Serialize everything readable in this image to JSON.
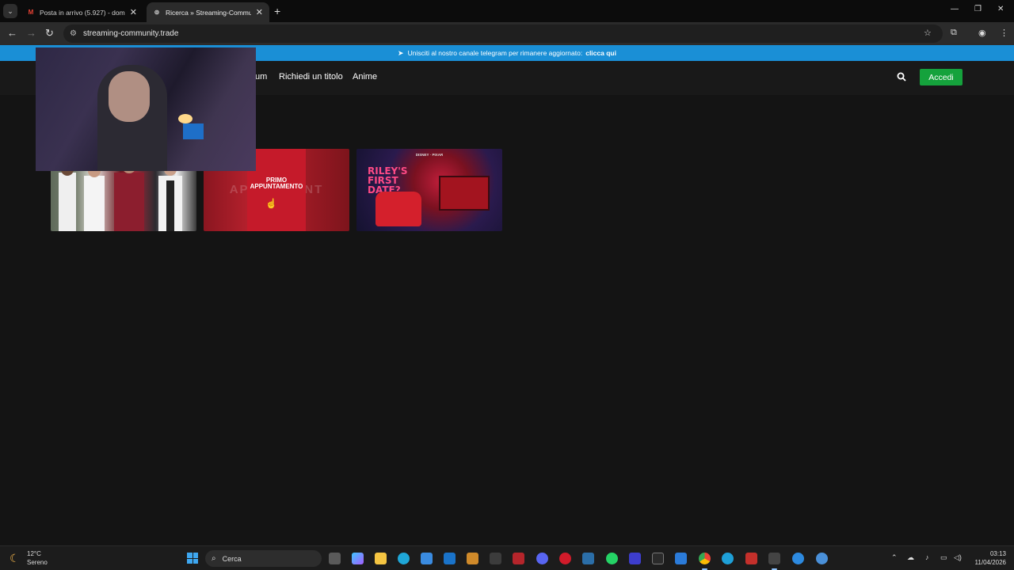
{
  "browser": {
    "tabs": [
      {
        "title": "Posta in arrivo (5.927) - domeni",
        "favicon": "gmail-icon"
      },
      {
        "title": "Ricerca » Streaming-Communit",
        "favicon": "streaming-icon"
      }
    ],
    "url": "streaming-community.trade"
  },
  "banner": {
    "text": "Unisciti al nostro canale telegram per rimanere aggiornato:",
    "cta": "clicca qui"
  },
  "site": {
    "nav": {
      "partial": "um",
      "request": "Richiedi un titolo",
      "anime": "Anime"
    },
    "login": "Accedi",
    "accent_color": "#15a23c"
  },
  "results": {
    "thumb2_title": "PRIMO APPUNTAMENTO",
    "thumb2_bgtext": "APPU          AMENT",
    "thumb3_brand": "DISNEY · PIXAR",
    "thumb3_title": "RILEY'S FIRST DATE?"
  },
  "taskbar": {
    "weather_temp": "12°C",
    "weather_cond": "Sereno",
    "search": "Cerca",
    "time": "03:13",
    "date": "11/04/2026"
  }
}
